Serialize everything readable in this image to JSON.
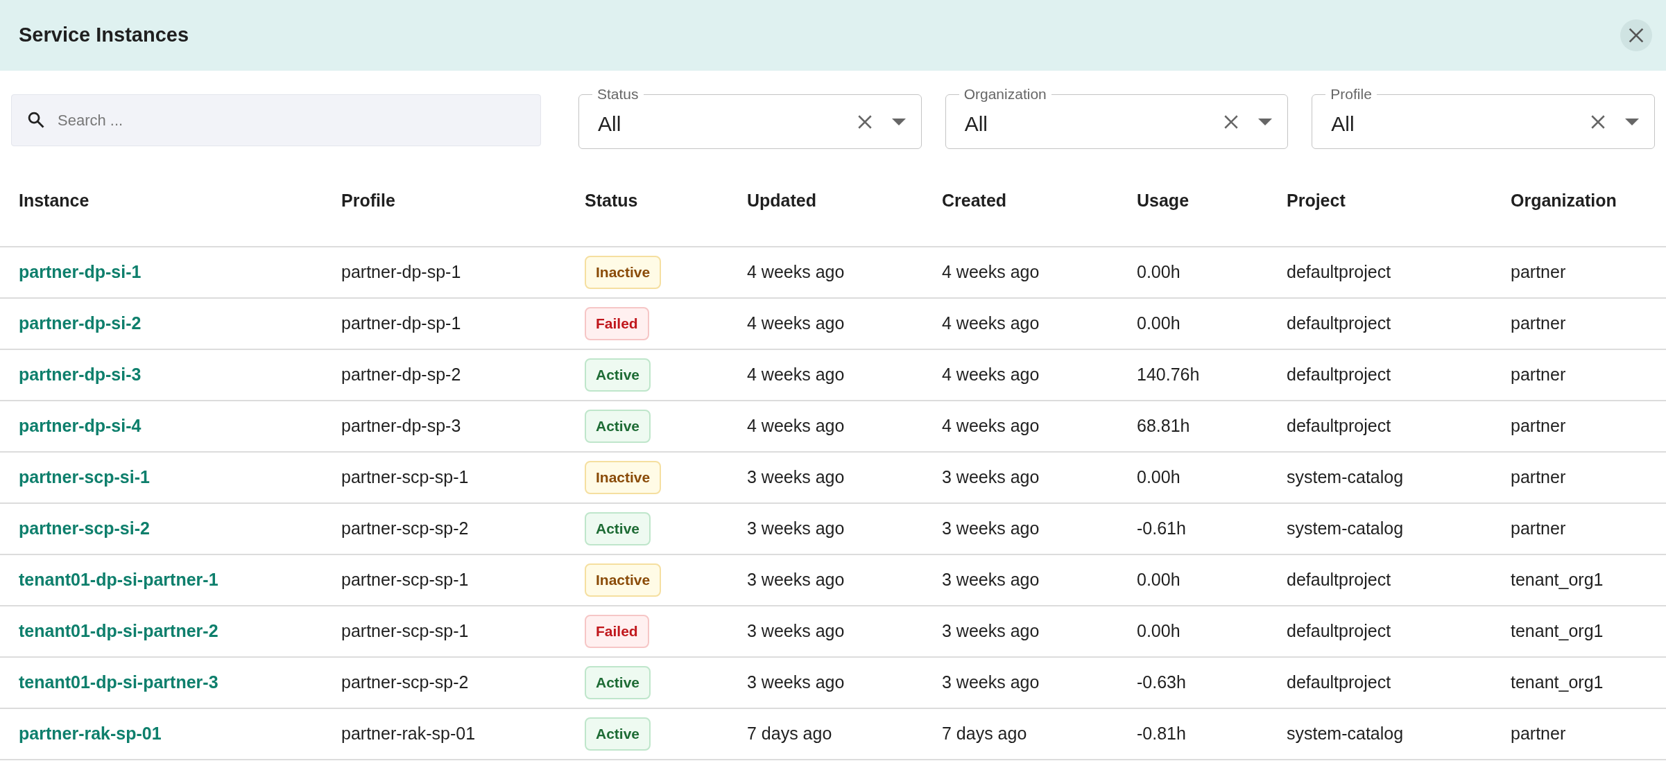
{
  "header": {
    "title": "Service Instances"
  },
  "search": {
    "placeholder": "Search ..."
  },
  "filters": [
    {
      "label": "Status",
      "value": "All"
    },
    {
      "label": "Organization",
      "value": "All"
    },
    {
      "label": "Profile",
      "value": "All"
    }
  ],
  "table": {
    "columns": [
      "Instance",
      "Profile",
      "Status",
      "Updated",
      "Created",
      "Usage",
      "Project",
      "Organization"
    ],
    "rows": [
      {
        "instance": "partner-dp-si-1",
        "profile": "partner-dp-sp-1",
        "status": {
          "label": "Inactive",
          "kind": "inactive"
        },
        "updated": "4 weeks ago",
        "created": "4 weeks ago",
        "usage": "0.00h",
        "project": "defaultproject",
        "organization": "partner"
      },
      {
        "instance": "partner-dp-si-2",
        "profile": "partner-dp-sp-1",
        "status": {
          "label": "Failed",
          "kind": "failed"
        },
        "updated": "4 weeks ago",
        "created": "4 weeks ago",
        "usage": "0.00h",
        "project": "defaultproject",
        "organization": "partner"
      },
      {
        "instance": "partner-dp-si-3",
        "profile": "partner-dp-sp-2",
        "status": {
          "label": "Active",
          "kind": "active"
        },
        "updated": "4 weeks ago",
        "created": "4 weeks ago",
        "usage": "140.76h",
        "project": "defaultproject",
        "organization": "partner"
      },
      {
        "instance": "partner-dp-si-4",
        "profile": "partner-dp-sp-3",
        "status": {
          "label": "Active",
          "kind": "active"
        },
        "updated": "4 weeks ago",
        "created": "4 weeks ago",
        "usage": "68.81h",
        "project": "defaultproject",
        "organization": "partner"
      },
      {
        "instance": "partner-scp-si-1",
        "profile": "partner-scp-sp-1",
        "status": {
          "label": "Inactive",
          "kind": "inactive"
        },
        "updated": "3 weeks ago",
        "created": "3 weeks ago",
        "usage": "0.00h",
        "project": "system-catalog",
        "organization": "partner"
      },
      {
        "instance": "partner-scp-si-2",
        "profile": "partner-scp-sp-2",
        "status": {
          "label": "Active",
          "kind": "active"
        },
        "updated": "3 weeks ago",
        "created": "3 weeks ago",
        "usage": "-0.61h",
        "project": "system-catalog",
        "organization": "partner"
      },
      {
        "instance": "tenant01-dp-si-partner-1",
        "profile": "partner-scp-sp-1",
        "status": {
          "label": "Inactive",
          "kind": "inactive"
        },
        "updated": "3 weeks ago",
        "created": "3 weeks ago",
        "usage": "0.00h",
        "project": "defaultproject",
        "organization": "tenant_org1"
      },
      {
        "instance": "tenant01-dp-si-partner-2",
        "profile": "partner-scp-sp-1",
        "status": {
          "label": "Failed",
          "kind": "failed"
        },
        "updated": "3 weeks ago",
        "created": "3 weeks ago",
        "usage": "0.00h",
        "project": "defaultproject",
        "organization": "tenant_org1"
      },
      {
        "instance": "tenant01-dp-si-partner-3",
        "profile": "partner-scp-sp-2",
        "status": {
          "label": "Active",
          "kind": "active"
        },
        "updated": "3 weeks ago",
        "created": "3 weeks ago",
        "usage": "-0.63h",
        "project": "defaultproject",
        "organization": "tenant_org1"
      },
      {
        "instance": "partner-rak-sp-01",
        "profile": "partner-rak-sp-01",
        "status": {
          "label": "Active",
          "kind": "active"
        },
        "updated": "7 days ago",
        "created": "7 days ago",
        "usage": "-0.81h",
        "project": "system-catalog",
        "organization": "partner"
      }
    ]
  }
}
